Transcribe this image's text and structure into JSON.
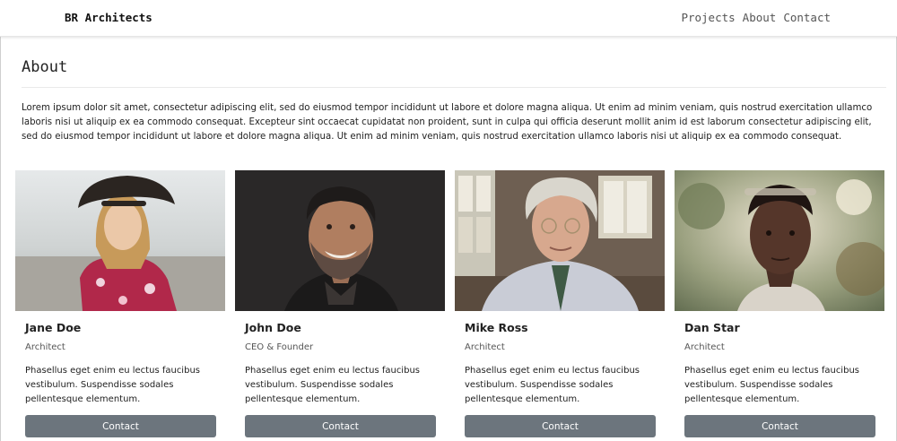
{
  "navbar": {
    "brand": "BR Architects",
    "links": [
      "Projects",
      "About",
      "Contact"
    ]
  },
  "about": {
    "title": "About",
    "text": "Lorem ipsum dolor sit amet, consectetur adipiscing elit, sed do eiusmod tempor incididunt ut labore et dolore magna aliqua. Ut enim ad minim veniam, quis nostrud exercitation ullamco laboris nisi ut aliquip ex ea commodo consequat. Excepteur sint occaecat cupidatat non proident, sunt in culpa qui officia deserunt mollit anim id est laborum consectetur adipiscing elit, sed do eiusmod tempor incididunt ut labore et dolore magna aliqua. Ut enim ad minim veniam, quis nostrud exercitation ullamco laboris nisi ut aliquip ex ea commodo consequat."
  },
  "team": [
    {
      "name": "Jane Doe",
      "role": "Architect",
      "description": "Phasellus eget enim eu lectus faucibus vestibulum. Suspendisse sodales pellentesque elementum.",
      "button": "Contact"
    },
    {
      "name": "John Doe",
      "role": "CEO & Founder",
      "description": "Phasellus eget enim eu lectus faucibus vestibulum. Suspendisse sodales pellentesque elementum.",
      "button": "Contact"
    },
    {
      "name": "Mike Ross",
      "role": "Architect",
      "description": "Phasellus eget enim eu lectus faucibus vestibulum. Suspendisse sodales pellentesque elementum.",
      "button": "Contact"
    },
    {
      "name": "Dan Star",
      "role": "Architect",
      "description": "Phasellus eget enim eu lectus faucibus vestibulum. Suspendisse sodales pellentesque elementum.",
      "button": "Contact"
    }
  ],
  "colors": {
    "button": "#6c757d",
    "button_text": "#ffffff"
  }
}
